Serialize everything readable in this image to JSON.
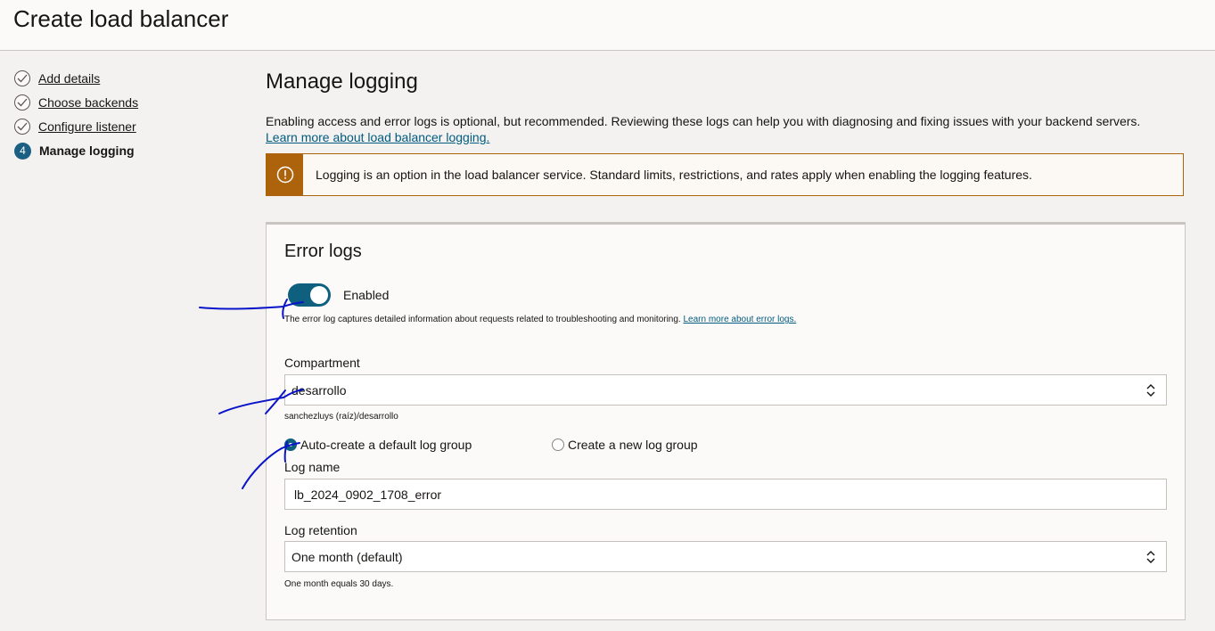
{
  "page": {
    "title": "Create load balancer"
  },
  "steps": [
    {
      "number": "",
      "label": "Add details",
      "state": "completed"
    },
    {
      "number": "",
      "label": "Choose backends",
      "state": "completed"
    },
    {
      "number": "",
      "label": "Configure listener",
      "state": "completed"
    },
    {
      "number": "4",
      "label": "Manage logging",
      "state": "current"
    }
  ],
  "main": {
    "title": "Manage logging",
    "intro": "Enabling access and error logs is optional, but recommended. Reviewing these logs can help you with diagnosing and fixing issues with your backend servers.",
    "intro_link": "Learn more about load balancer logging.",
    "notice": "Logging is an option in the load balancer service. Standard limits, restrictions, and rates apply when enabling the logging features."
  },
  "error_logs": {
    "title": "Error logs",
    "toggle_label": "Enabled",
    "toggle_on": true,
    "help_text": "The error log captures detailed information about requests related to troubleshooting and monitoring.",
    "help_link": "Learn more about error logs.",
    "compartment_label": "Compartment",
    "compartment_value": "desarrollo",
    "compartment_path": "sanchezluys (raíz)/desarrollo",
    "radio_auto": "Auto-create a default log group",
    "radio_new": "Create a new log group",
    "selected_radio": "auto",
    "log_name_label": "Log name",
    "log_name_value": "lb_2024_0902_1708_error",
    "retention_label": "Log retention",
    "retention_value": "One month (default)",
    "retention_help": "One month equals 30 days."
  },
  "colors": {
    "accent": "#0f5f7e",
    "warning": "#ac630c",
    "annotation": "#0a14c8"
  }
}
